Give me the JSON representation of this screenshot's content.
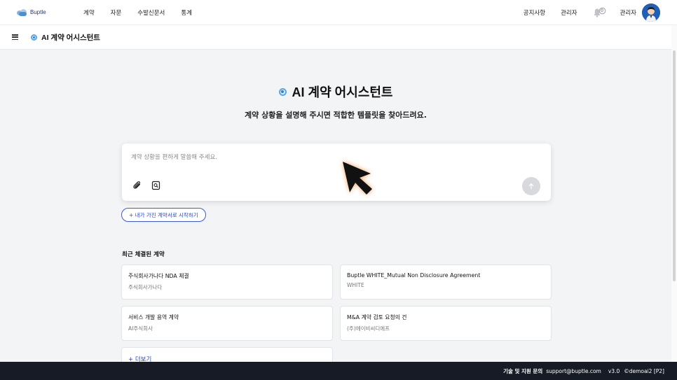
{
  "topnav": {
    "logo_text": "Buptle",
    "menu": [
      "계약",
      "자문",
      "수발신문서",
      "통계"
    ],
    "right": {
      "notice": "공지사항",
      "admin_link": "관리자",
      "bell_count": "0",
      "user": "관리자"
    }
  },
  "subheader": {
    "title": "AI 계약 어시스턴트"
  },
  "hero": {
    "title": "AI 계약 어시스턴트",
    "subtitle": "계약 상황을 설명해 주시면 적합한 템플릿을 찾아드려요."
  },
  "input": {
    "placeholder": "계약 상황을 편하게 말씀해 주세요.",
    "value": ""
  },
  "start_button": "+ 내가 가진 계약서로 시작하기",
  "recent": {
    "title": "최근 체결된 계약",
    "items": [
      {
        "title": "주식회사가나다 NDA 체결",
        "party": "주식회사가나다"
      },
      {
        "title": "Buptle WHITE_Mutual Non Disclosure Agreement",
        "party": "WHITE"
      },
      {
        "title": "서비스 개발 용역 계약",
        "party": "AI주식회사"
      },
      {
        "title": "M&A 계약 검토 요청의 건",
        "party": "(주)에이비씨디에프"
      }
    ],
    "more": "+ 더보기"
  },
  "footer": {
    "support_label": "기술 및 지원 문의",
    "email": "support@buptle.com",
    "version": "v3.0",
    "copyright": "©demoai2 [P2]"
  },
  "colors": {
    "accent": "#2745c4",
    "footer_bg": "#161b26",
    "cursor": "#111111",
    "cursor_glow": "#f08a3c"
  },
  "icons": [
    "hamburger-icon",
    "assistant-dot-icon",
    "paperclip-icon",
    "search-document-icon",
    "arrow-up-icon",
    "bell-icon",
    "user-avatar-icon",
    "cursor-arrow-icon"
  ]
}
